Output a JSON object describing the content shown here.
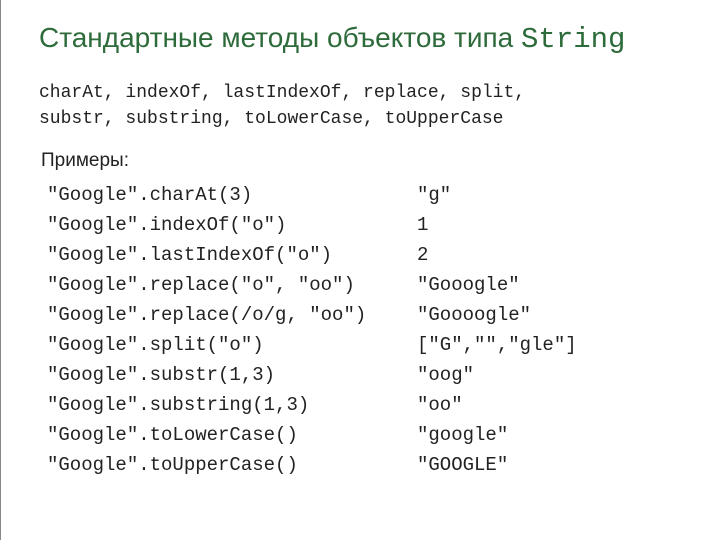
{
  "title_pre": "Стандартные методы объектов типа ",
  "title_code": "String",
  "methods_line1": "charAt, indexOf, lastIndexOf, replace, split,",
  "methods_line2": "substr, substring, toLowerCase, toUpperCase",
  "examples_label": "Примеры:",
  "rows": [
    {
      "expr": "\"Google\".charAt(3)",
      "result": "\"g\""
    },
    {
      "expr": "\"Google\".indexOf(\"o\")",
      "result": "1"
    },
    {
      "expr": "\"Google\".lastIndexOf(\"o\")",
      "result": "2"
    },
    {
      "expr": "\"Google\".replace(\"o\", \"oo\")",
      "result": "\"Gooogle\""
    },
    {
      "expr": "\"Google\".replace(/o/g, \"oo\")",
      "result": "\"Goooogle\""
    },
    {
      "expr": "\"Google\".split(\"o\")",
      "result": "[\"G\",\"\",\"gle\"]"
    },
    {
      "expr": "\"Google\".substr(1,3)",
      "result": "\"oog\""
    },
    {
      "expr": "\"Google\".substring(1,3)",
      "result": "\"oo\""
    },
    {
      "expr": "\"Google\".toLowerCase()",
      "result": "\"google\""
    },
    {
      "expr": "\"Google\".toUpperCase()",
      "result": "\"GOOGLE\""
    }
  ]
}
